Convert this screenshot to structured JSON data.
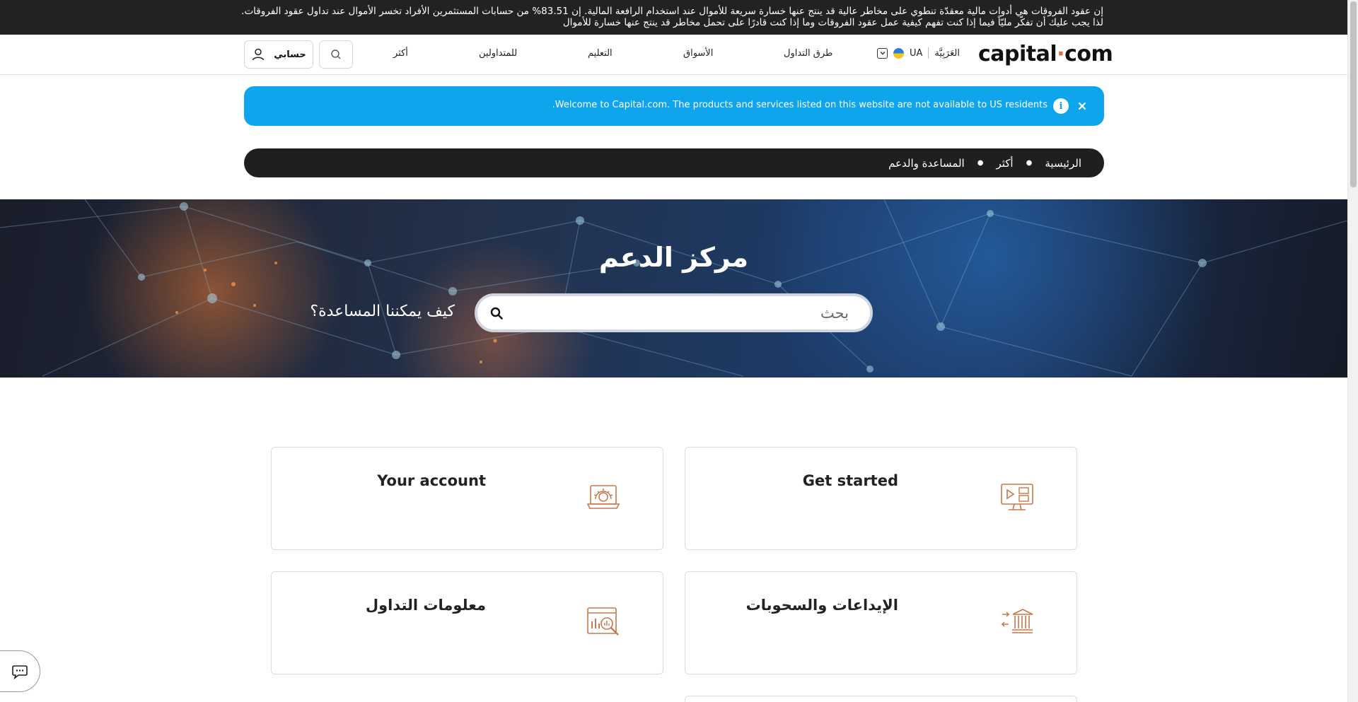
{
  "risk_banner": {
    "text": "إن عقود الفروقات هي أدوات مالية معقدّة تنطوي على مخاطر عالية قد ينتج عنها خسارة سريعة للأموال عند استخدام الرافعة المالية. إن 83.51% من حسابات المستثمرين الأفراد تخسر الأموال عند تداول عقود الفروقات. لذا يجب عليك أن تفكّر مليّاً فيما إذا كنت تفهم كيفية عمل عقود الفروقات وما إذا كنت قادرًا على تحمل مخاطر قد ينتج عنها خسارة للأموال"
  },
  "header": {
    "logo_main": "capital",
    "logo_dot": "·",
    "logo_suffix": "com",
    "region": "UA",
    "language": "العَرَبِيَّة",
    "nav": [
      "طرق التداول",
      "الأسواق",
      "التعليم",
      "للمتداولين",
      "أكثر"
    ],
    "account_label": "حسابي"
  },
  "info_banner": {
    "text": "Welcome to Capital.com. The products and services listed on this website are not available to US residents."
  },
  "breadcrumb": [
    "الرئيسية",
    "أكثر",
    "المساعدة والدعم"
  ],
  "hero": {
    "title": "مركز الدعم",
    "question": "كيف يمكننا المساعدة؟",
    "search_placeholder": "بحث"
  },
  "cards": [
    {
      "title": "Get started",
      "icon": "video-screen-icon"
    },
    {
      "title": "Your account",
      "icon": "laptop-gear-icon"
    },
    {
      "title": "الإيداعات والسحوبات",
      "icon": "bank-transfer-icon"
    },
    {
      "title": "معلومات التداول",
      "icon": "chart-magnifier-icon"
    }
  ],
  "colors": {
    "accent": "#c8774a",
    "banner_blue": "#0ea5ec",
    "dark": "#1f1f1f"
  }
}
